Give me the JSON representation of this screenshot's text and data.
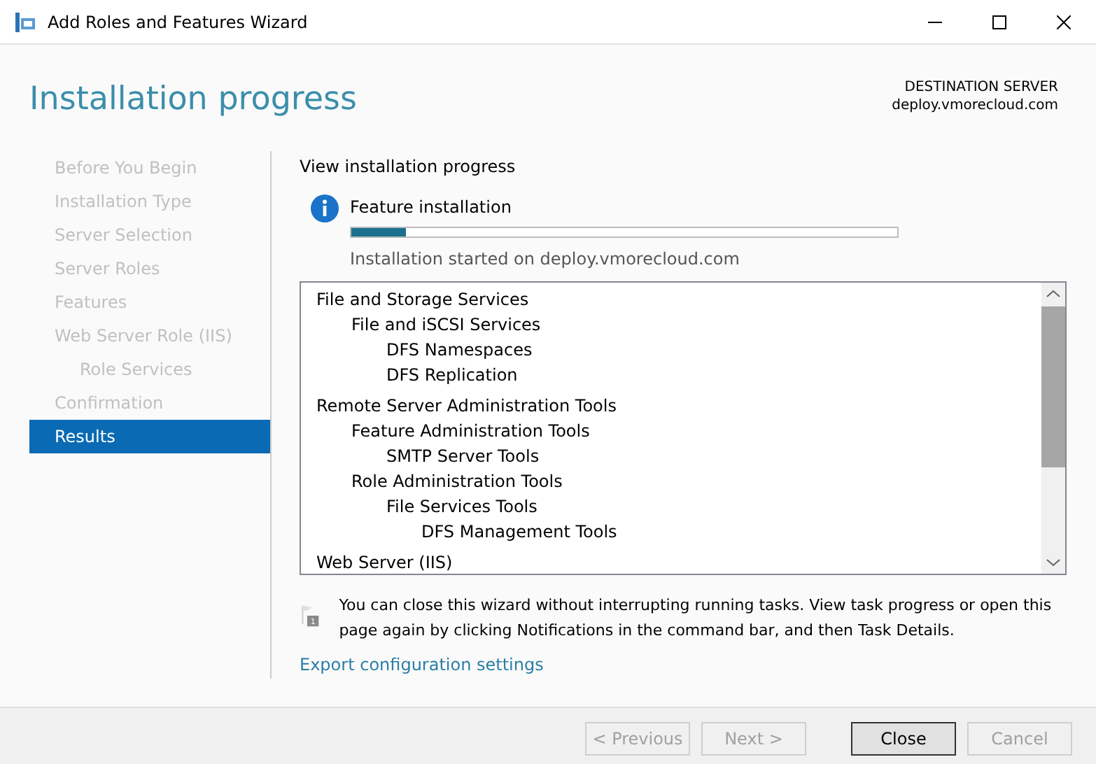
{
  "window": {
    "title": "Add Roles and Features Wizard"
  },
  "header": {
    "title": "Installation progress",
    "server_label": "DESTINATION SERVER",
    "server_name": "deploy.vmorecloud.com"
  },
  "sidebar": {
    "items": [
      {
        "label": "Before You Begin",
        "selected": false,
        "disabled": true
      },
      {
        "label": "Installation Type",
        "selected": false,
        "disabled": true
      },
      {
        "label": "Server Selection",
        "selected": false,
        "disabled": true
      },
      {
        "label": "Server Roles",
        "selected": false,
        "disabled": true
      },
      {
        "label": "Features",
        "selected": false,
        "disabled": true
      },
      {
        "label": "Web Server Role (IIS)",
        "selected": false,
        "disabled": true,
        "children": [
          {
            "label": "Role Services",
            "selected": false,
            "disabled": true
          }
        ]
      },
      {
        "label": "Confirmation",
        "selected": false,
        "disabled": true
      },
      {
        "label": "Results",
        "selected": true,
        "disabled": false
      }
    ]
  },
  "content": {
    "heading": "View installation progress",
    "status": {
      "title": "Feature installation",
      "level": 0.1,
      "message": "Installation started on deploy.vmorecloud.com"
    },
    "tree": [
      {
        "label": "File and Storage Services",
        "children": [
          {
            "label": "File and iSCSI Services",
            "children": [
              {
                "label": "DFS Namespaces"
              },
              {
                "label": "DFS Replication"
              }
            ]
          }
        ]
      },
      {
        "label": "Remote Server Administration Tools",
        "children": [
          {
            "label": "Feature Administration Tools",
            "children": [
              {
                "label": "SMTP Server Tools"
              }
            ]
          },
          {
            "label": "Role Administration Tools",
            "children": [
              {
                "label": "File Services Tools",
                "children": [
                  {
                    "label": "DFS Management Tools"
                  }
                ]
              }
            ]
          }
        ]
      },
      {
        "label": "Web Server (IIS)"
      }
    ],
    "notification_count": "1",
    "note": "You can close this wizard without interrupting running tasks. View task progress or open this page again by clicking Notifications in the command bar, and then Task Details.",
    "link": "Export configuration settings"
  },
  "buttons": [
    {
      "label": "< Previous",
      "disabled": true,
      "default": false
    },
    {
      "label": "Next >",
      "disabled": true,
      "default": false
    },
    {
      "label": "Close",
      "disabled": false,
      "default": true
    },
    {
      "label": "Cancel",
      "disabled": true,
      "default": false
    }
  ]
}
